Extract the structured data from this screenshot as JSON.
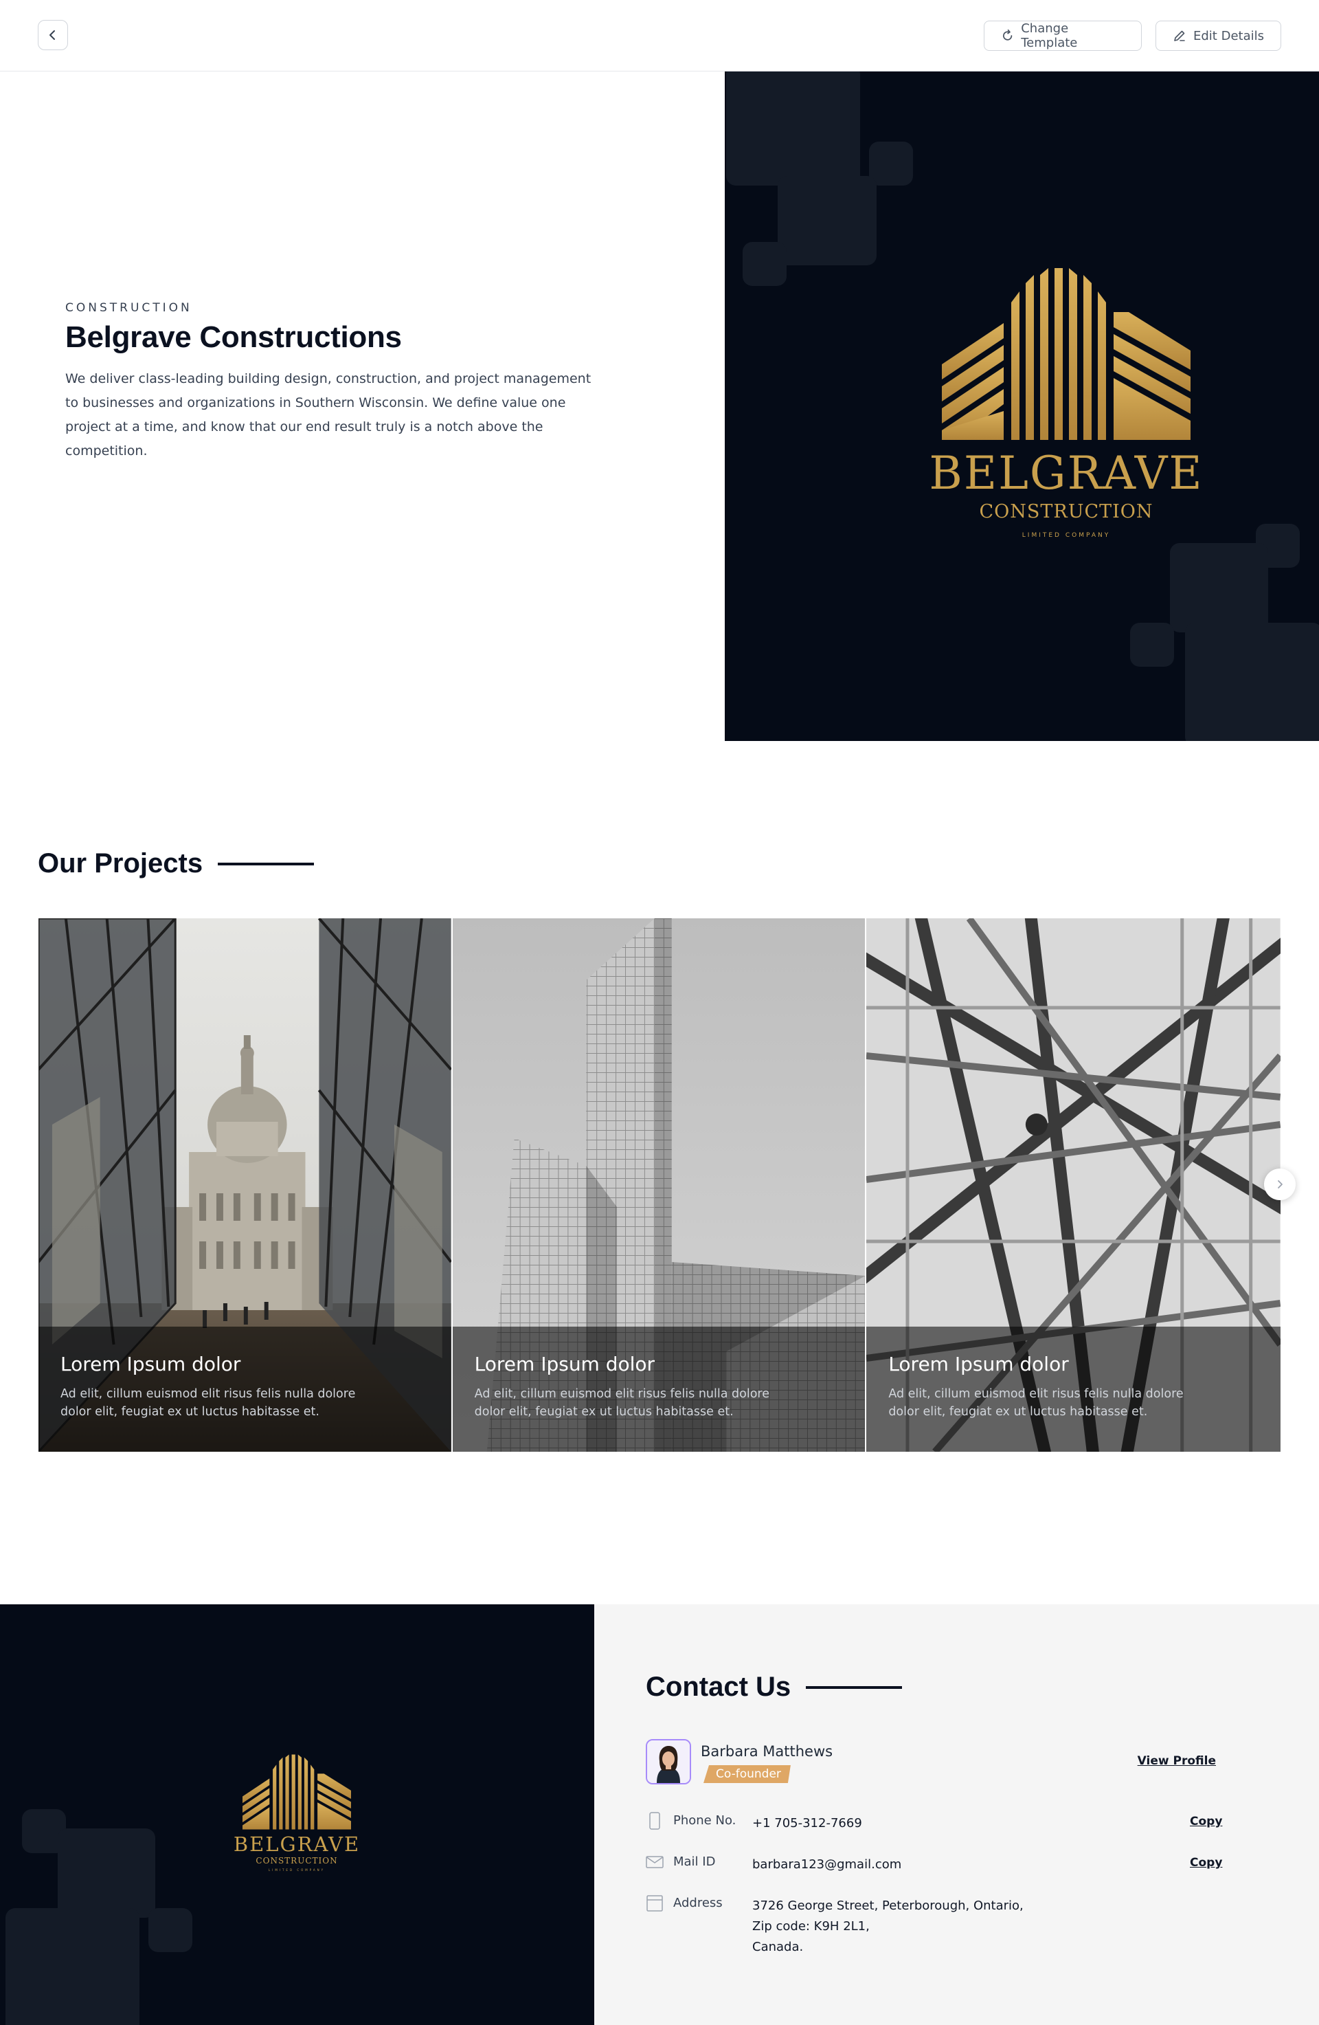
{
  "topbar": {
    "change_template_label": "Change Template",
    "edit_details_label": "Edit Details"
  },
  "hero": {
    "eyebrow": "CONSTRUCTION",
    "title": "Belgrave Constructions",
    "description": "We deliver class-leading building design, construction, and project management to businesses and organizations in Southern Wisconsin. We define value one project at a time, and know that our end result truly is a notch above the competition."
  },
  "logo": {
    "name": "BELGRAVE",
    "subtitle": "CONSTRUCTION",
    "tagline": "LIMITED COMPANY",
    "color": "#c9a04d"
  },
  "projects": {
    "title": "Our Projects",
    "cards": [
      {
        "title": "Lorem Ipsum dolor",
        "description": "Ad elit, cillum euismod elit risus felis nulla dolore dolor elit, feugiat ex ut luctus habitasse et."
      },
      {
        "title": "Lorem Ipsum dolor",
        "description": "Ad elit, cillum euismod elit risus felis nulla dolore dolor elit, feugiat ex ut luctus habitasse et."
      },
      {
        "title": "Lorem Ipsum dolor",
        "description": "Ad elit, cillum euismod elit risus felis nulla dolore dolor elit, feugiat ex ut luctus habitasse et."
      }
    ]
  },
  "contact": {
    "title": "Contact Us",
    "person": {
      "name": "Barbara Matthews",
      "role": "Co-founder",
      "view_profile_label": "View Profile"
    },
    "phone": {
      "label": "Phone No.",
      "value": "+1 705-312-7669",
      "copy_label": "Copy"
    },
    "mail": {
      "label": "Mail ID",
      "value": "barbara123@gmail.com",
      "copy_label": "Copy"
    },
    "address": {
      "label": "Address",
      "line1": "3726 George Street, Peterborough, Ontario,",
      "line2": "Zip code: K9H 2L1,",
      "line3": "Canada."
    }
  },
  "colors": {
    "dark_panel": "#050b17",
    "accent_gold": "#c9a04d",
    "badge": "#dfa765"
  }
}
